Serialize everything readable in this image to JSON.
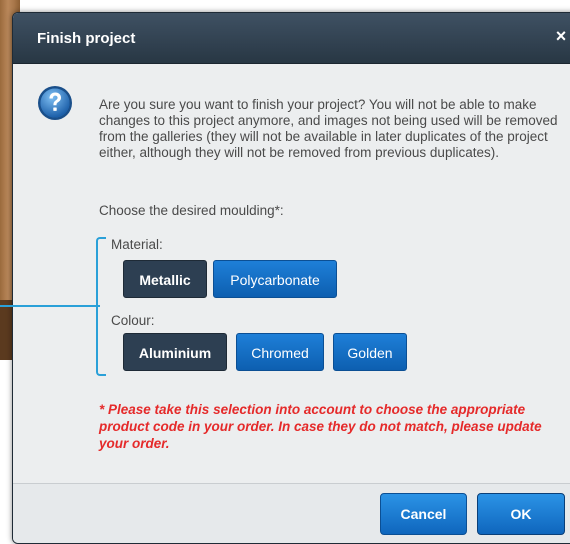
{
  "dialog": {
    "title": "Finish project",
    "close_symbol": "×",
    "icon": "help-question-icon",
    "intro": "Are you sure you want to finish your project? You will not be able to make changes to this project anymore, and images not being used will be removed from the galleries (they will not be available in later duplicates of the project either, although they will not be removed from previous duplicates).",
    "moulding_prompt": "Choose the desired moulding*:",
    "material": {
      "label": "Material:",
      "options": [
        {
          "label": "Metallic",
          "selected": true
        },
        {
          "label": "Polycarbonate",
          "selected": false
        }
      ]
    },
    "colour": {
      "label": "Colour:",
      "options": [
        {
          "label": "Aluminium",
          "selected": true
        },
        {
          "label": "Chromed",
          "selected": false
        },
        {
          "label": "Golden",
          "selected": false
        }
      ]
    },
    "note": "* Please take this selection into account to choose the appropriate product code in your order. In case they do not match, please update your order.",
    "buttons": {
      "cancel": "Cancel",
      "ok": "OK"
    }
  },
  "colors": {
    "header": "#2f3f4f",
    "accent_blue": "#1166c2",
    "selected_option": "#2d3f52",
    "note_red": "#e52a2a",
    "connector": "#2aa0d8"
  }
}
